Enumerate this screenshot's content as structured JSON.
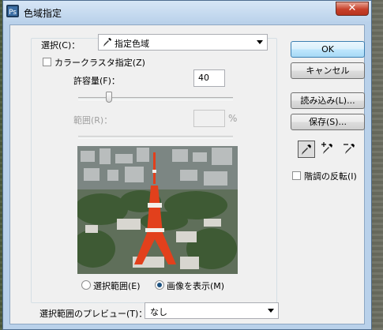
{
  "window": {
    "title": "色域指定",
    "close_label": "✕"
  },
  "select": {
    "label": "選択(C)：",
    "value": "指定色域",
    "icon": "eyedropper-icon"
  },
  "cluster": {
    "label": "カラークラスタ指定(Z)",
    "checked": false
  },
  "tolerance": {
    "label": "許容量(F)：",
    "value": "40",
    "slider_fraction": 0.2
  },
  "range": {
    "label": "範囲(R)：",
    "value": "",
    "unit": "%",
    "disabled": true
  },
  "view_options": {
    "selection_label": "選択範囲(E)",
    "image_label": "画像を表示(M)",
    "selected": "image"
  },
  "preview_select": {
    "label": "選択範囲のプレビュー(T)：",
    "value": "なし"
  },
  "buttons": {
    "ok": "OK",
    "cancel": "キャンセル",
    "load": "読み込み(L)...",
    "save": "保存(S)..."
  },
  "tools": [
    {
      "icon": "eyedropper-icon",
      "active": true
    },
    {
      "icon": "eyedropper-plus-icon",
      "active": false
    },
    {
      "icon": "eyedropper-minus-icon",
      "active": false
    }
  ],
  "invert": {
    "label": "階調の反転(I)",
    "checked": false
  },
  "colors": {
    "tower_red": "#e2401c",
    "tower_white": "#f3f0ea",
    "default_button": "#3c7fb1"
  }
}
